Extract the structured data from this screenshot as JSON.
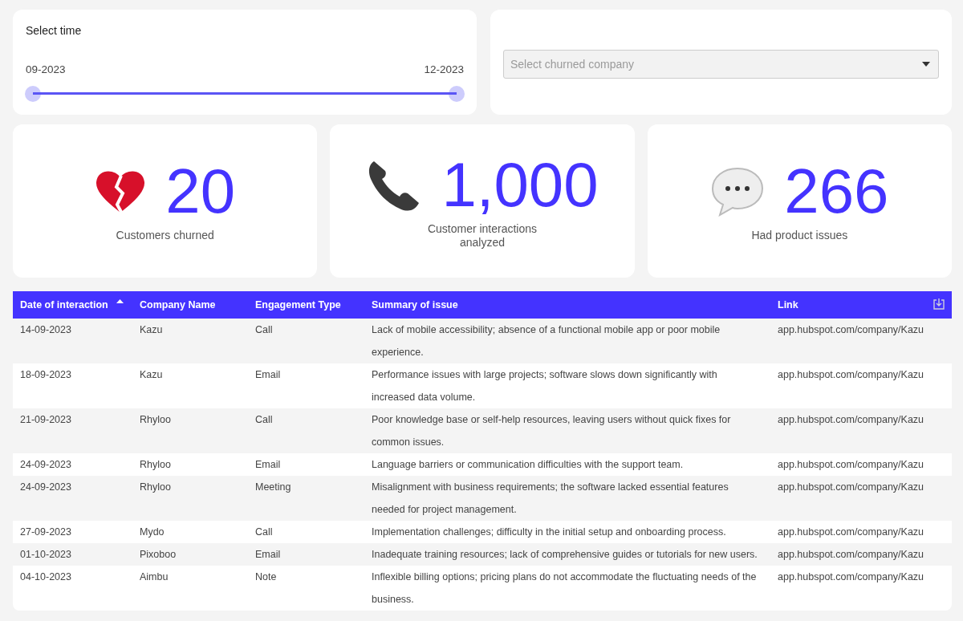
{
  "time_filter": {
    "title": "Select time",
    "start_label": "09-2023",
    "end_label": "12-2023",
    "handles": [
      {
        "level": 0
      },
      {
        "level": 1
      }
    ]
  },
  "company_filter": {
    "placeholder": "Select churned company"
  },
  "stats": [
    {
      "kind": "broken-heart",
      "value": "20",
      "label": "Customers churned"
    },
    {
      "kind": "phone",
      "value": "1,000",
      "label": "Customer interactions analyzed"
    },
    {
      "kind": "speech",
      "value": "266",
      "label": "Had product issues"
    }
  ],
  "table": {
    "columns": [
      {
        "label": "Date of interaction",
        "sorted": true
      },
      {
        "label": "Company Name",
        "sorted": false
      },
      {
        "label": "Engagement Type",
        "sorted": false
      },
      {
        "label": "Summary of issue",
        "sorted": false
      },
      {
        "label": "Link",
        "sorted": false
      }
    ],
    "rows": [
      [
        "14-09-2023",
        "Kazu",
        "Call",
        "Lack of mobile accessibility; absence of a functional mobile app or poor mobile experience.",
        "app.hubspot.com/company/Kazu"
      ],
      [
        "18-09-2023",
        "Kazu",
        "Email",
        "Performance issues with large projects; software slows down significantly with increased data volume.",
        "app.hubspot.com/company/Kazu"
      ],
      [
        "21-09-2023",
        "Rhyloo",
        "Call",
        "Poor knowledge base or self-help resources, leaving users without quick fixes for common issues.",
        "app.hubspot.com/company/Kazu"
      ],
      [
        "24-09-2023",
        "Rhyloo",
        "Email",
        "Language barriers or communication difficulties with the support team.",
        "app.hubspot.com/company/Kazu"
      ],
      [
        "24-09-2023",
        "Rhyloo",
        "Meeting",
        "Misalignment with business requirements; the software lacked essential features needed for project management.",
        "app.hubspot.com/company/Kazu"
      ],
      [
        "27-09-2023",
        "Mydo",
        "Call",
        "Implementation challenges; difficulty in the initial setup and onboarding process.",
        "app.hubspot.com/company/Kazu"
      ],
      [
        "01-10-2023",
        "Pixoboo",
        "Email",
        "Inadequate training resources; lack of comprehensive guides or tutorials for new users.",
        "app.hubspot.com/company/Kazu"
      ],
      [
        "04-10-2023",
        "Aimbu",
        "Note",
        "Inflexible billing options; pricing plans do not accommodate the fluctuating needs of the business.",
        "app.hubspot.com/company/Kazu"
      ]
    ]
  }
}
